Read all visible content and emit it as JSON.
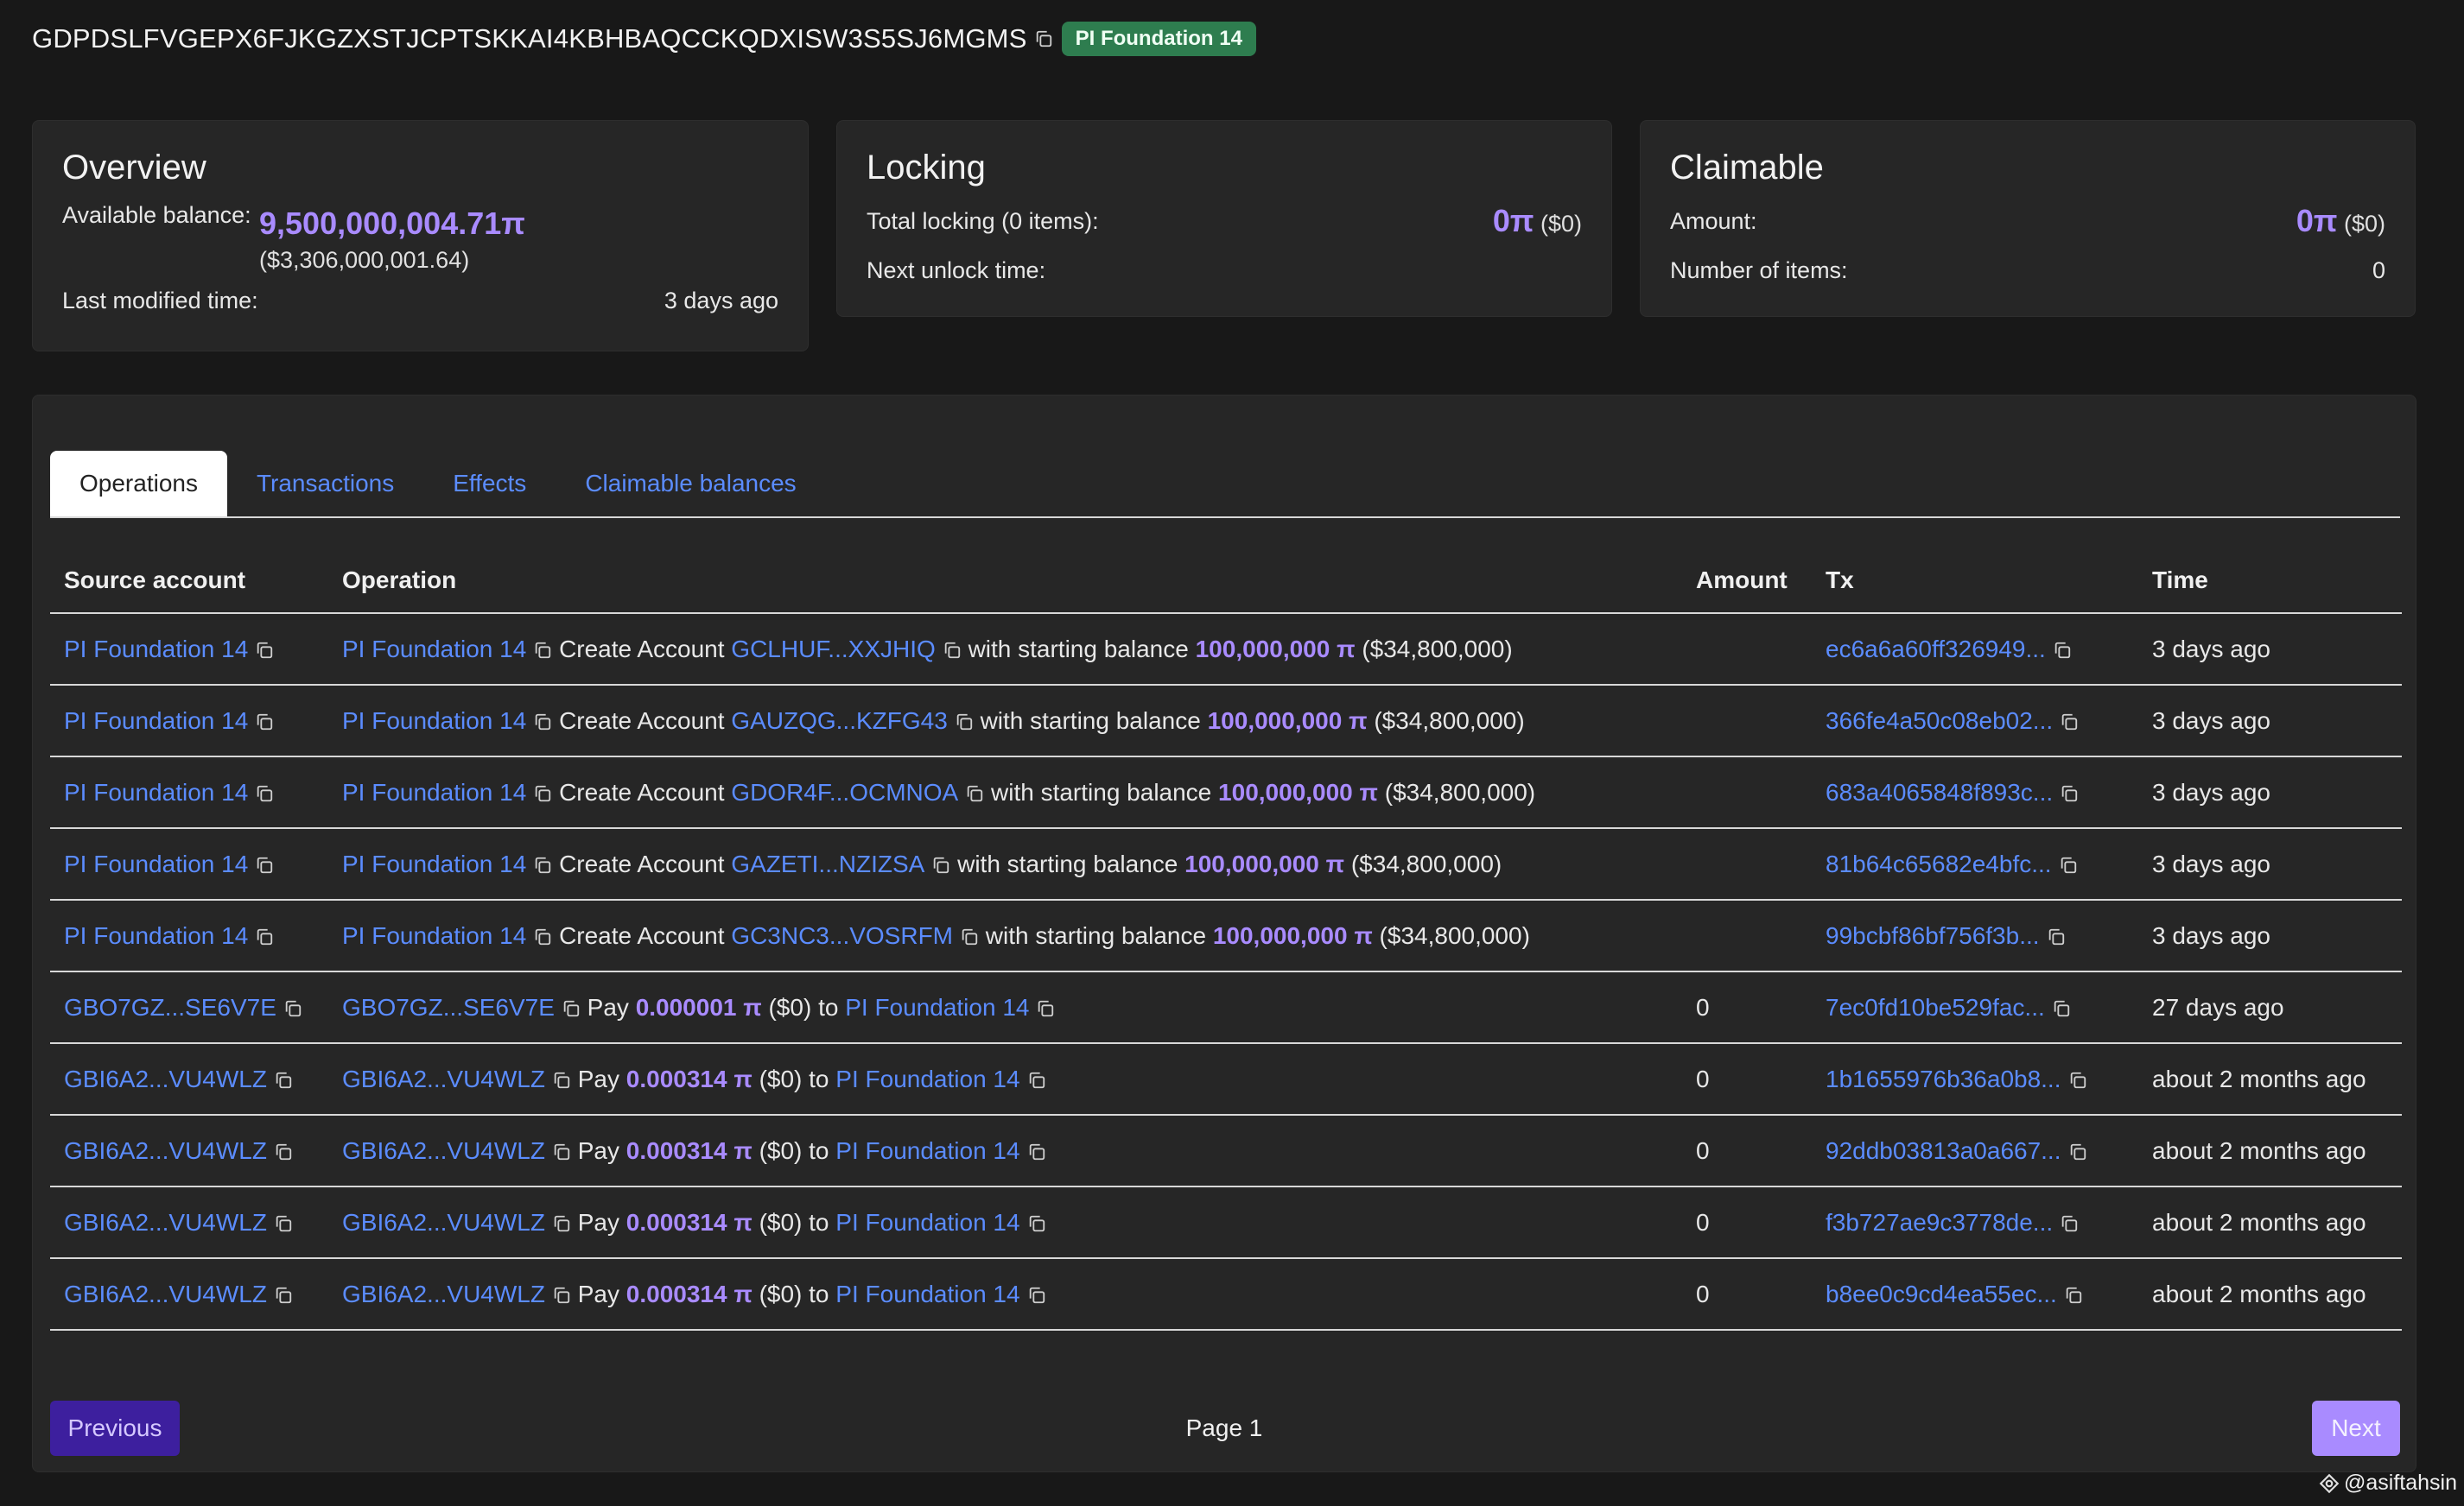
{
  "header": {
    "account_id": "GDPDSLFVGEPX6FJKGZXSTJCPTSKKAI4KBHBAQCCKQDXISW3S5SJ6MGMS",
    "badge": "PI Foundation 14"
  },
  "overview": {
    "title": "Overview",
    "available_label": "Available balance:",
    "available_value": "9,500,000,004.71π",
    "available_usd": "($3,306,000,001.64)",
    "modified_label": "Last modified time:",
    "modified_value": "3 days ago"
  },
  "locking": {
    "title": "Locking",
    "total_label": "Total locking (0 items):",
    "total_value": "0π",
    "total_usd": "($0)",
    "next_label": "Next unlock time:",
    "next_value": ""
  },
  "claimable": {
    "title": "Claimable",
    "amount_label": "Amount:",
    "amount_value": "0π",
    "amount_usd": "($0)",
    "items_label": "Number of items:",
    "items_value": "0"
  },
  "tabs": [
    {
      "label": "Operations",
      "active": true
    },
    {
      "label": "Transactions",
      "active": false
    },
    {
      "label": "Effects",
      "active": false
    },
    {
      "label": "Claimable balances",
      "active": false
    }
  ],
  "table": {
    "headers": {
      "source": "Source account",
      "operation": "Operation",
      "amount": "Amount",
      "tx": "Tx",
      "time": "Time"
    },
    "rows": [
      {
        "source": "PI Foundation 14",
        "op_from": "PI Foundation 14",
        "kind": "create",
        "verb": "Create Account",
        "target": "GCLHUF...XXJHIQ",
        "mid": "with starting balance",
        "value": "100,000,000 π",
        "usd": "($34,800,000)",
        "amount": "",
        "tx": "ec6a6a60ff326949...",
        "time": "3 days ago"
      },
      {
        "source": "PI Foundation 14",
        "op_from": "PI Foundation 14",
        "kind": "create",
        "verb": "Create Account",
        "target": "GAUZQG...KZFG43",
        "mid": "with starting balance",
        "value": "100,000,000 π",
        "usd": "($34,800,000)",
        "amount": "",
        "tx": "366fe4a50c08eb02...",
        "time": "3 days ago"
      },
      {
        "source": "PI Foundation 14",
        "op_from": "PI Foundation 14",
        "kind": "create",
        "verb": "Create Account",
        "target": "GDOR4F...OCMNOA",
        "mid": "with starting balance",
        "value": "100,000,000 π",
        "usd": "($34,800,000)",
        "amount": "",
        "tx": "683a4065848f893c...",
        "time": "3 days ago"
      },
      {
        "source": "PI Foundation 14",
        "op_from": "PI Foundation 14",
        "kind": "create",
        "verb": "Create Account",
        "target": "GAZETI...NZIZSA",
        "mid": "with starting balance",
        "value": "100,000,000 π",
        "usd": "($34,800,000)",
        "amount": "",
        "tx": "81b64c65682e4bfc...",
        "time": "3 days ago"
      },
      {
        "source": "PI Foundation 14",
        "op_from": "PI Foundation 14",
        "kind": "create",
        "verb": "Create Account",
        "target": "GC3NC3...VOSRFM",
        "mid": "with starting balance",
        "value": "100,000,000 π",
        "usd": "($34,800,000)",
        "amount": "",
        "tx": "99bcbf86bf756f3b...",
        "time": "3 days ago"
      },
      {
        "source": "GBO7GZ...SE6V7E",
        "op_from": "GBO7GZ...SE6V7E",
        "kind": "pay",
        "verb": "Pay",
        "value": "0.000001 π",
        "usd": "($0)",
        "mid": "to",
        "target": "PI Foundation 14",
        "amount": "0",
        "tx": "7ec0fd10be529fac...",
        "time": "27 days ago"
      },
      {
        "source": "GBI6A2...VU4WLZ",
        "op_from": "GBI6A2...VU4WLZ",
        "kind": "pay",
        "verb": "Pay",
        "value": "0.000314 π",
        "usd": "($0)",
        "mid": "to",
        "target": "PI Foundation 14",
        "amount": "0",
        "tx": "1b1655976b36a0b8...",
        "time": "about 2 months ago"
      },
      {
        "source": "GBI6A2...VU4WLZ",
        "op_from": "GBI6A2...VU4WLZ",
        "kind": "pay",
        "verb": "Pay",
        "value": "0.000314 π",
        "usd": "($0)",
        "mid": "to",
        "target": "PI Foundation 14",
        "amount": "0",
        "tx": "92ddb03813a0a667...",
        "time": "about 2 months ago"
      },
      {
        "source": "GBI6A2...VU4WLZ",
        "op_from": "GBI6A2...VU4WLZ",
        "kind": "pay",
        "verb": "Pay",
        "value": "0.000314 π",
        "usd": "($0)",
        "mid": "to",
        "target": "PI Foundation 14",
        "amount": "0",
        "tx": "f3b727ae9c3778de...",
        "time": "about 2 months ago"
      },
      {
        "source": "GBI6A2...VU4WLZ",
        "op_from": "GBI6A2...VU4WLZ",
        "kind": "pay",
        "verb": "Pay",
        "value": "0.000314 π",
        "usd": "($0)",
        "mid": "to",
        "target": "PI Foundation 14",
        "amount": "0",
        "tx": "b8ee0c9cd4ea55ec...",
        "time": "about 2 months ago"
      }
    ]
  },
  "pagination": {
    "previous": "Previous",
    "page": "Page 1",
    "next": "Next"
  },
  "watermark": "@asiftahsin",
  "colors": {
    "accent_purple": "#a98bff",
    "link_blue": "#5b8cff",
    "badge_green": "#2e7d4f",
    "prev_button": "#3d1f9e"
  }
}
